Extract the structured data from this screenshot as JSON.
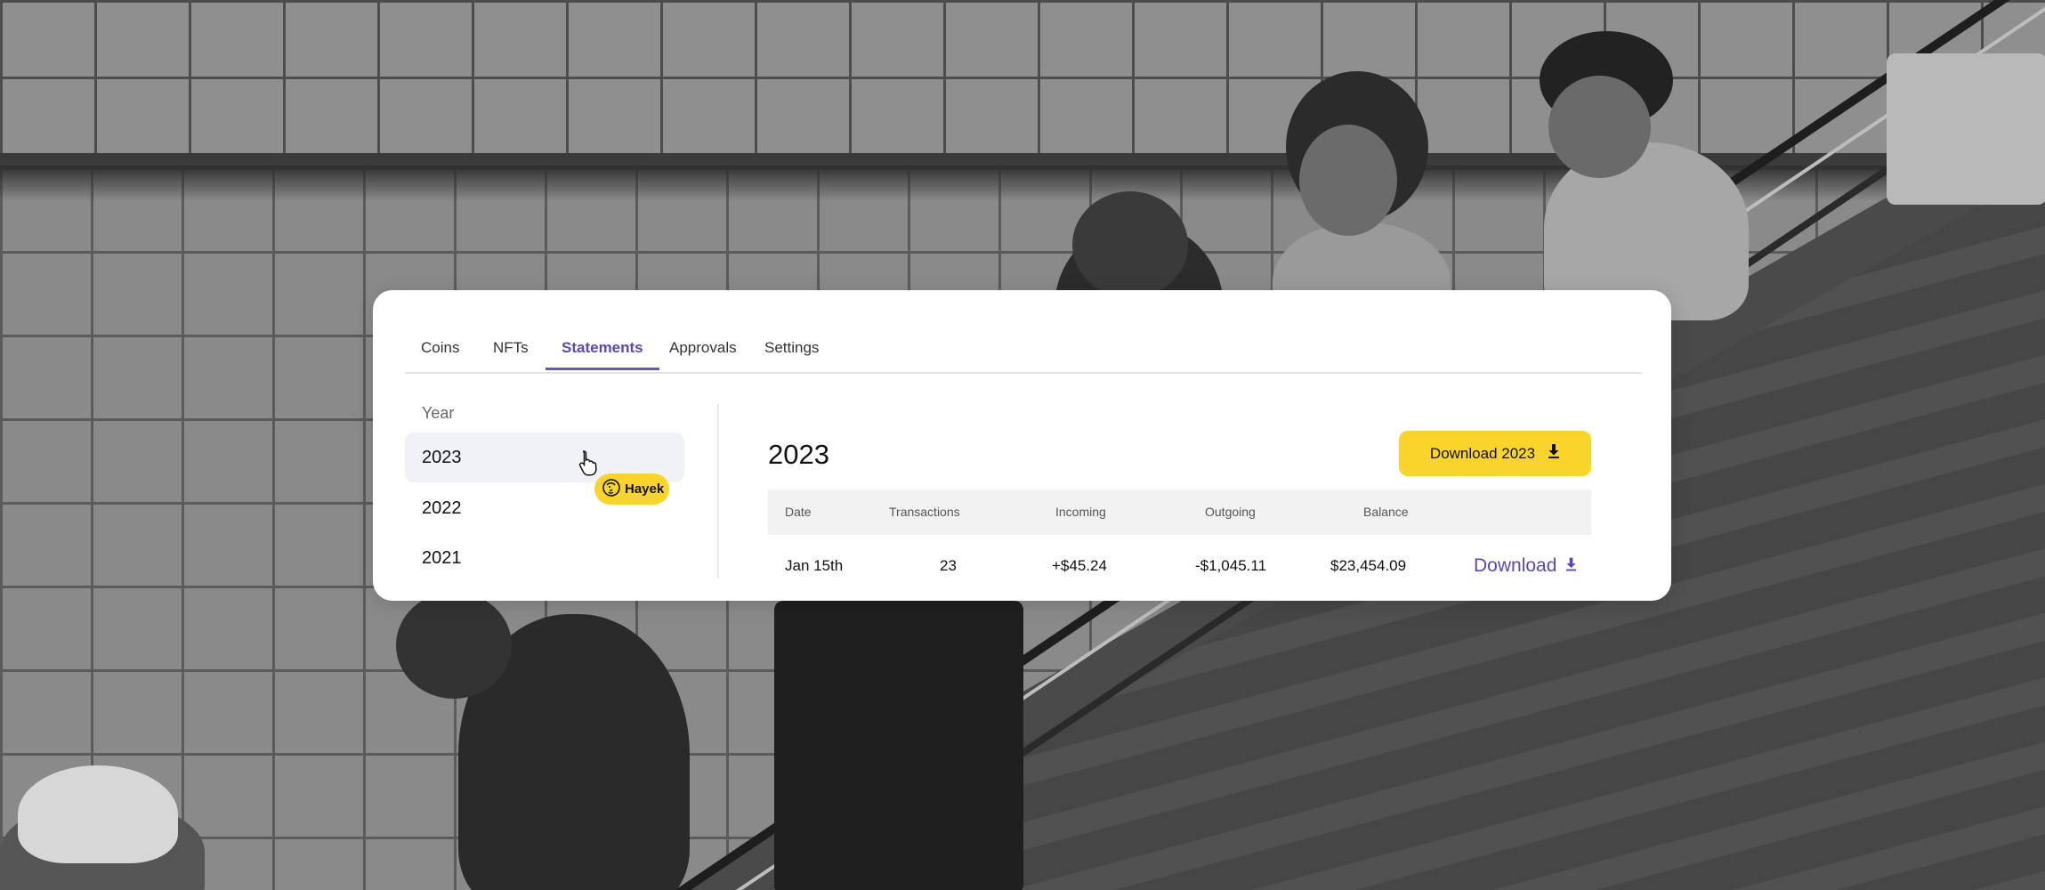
{
  "tabs": [
    {
      "label": "Coins"
    },
    {
      "label": "NFTs"
    },
    {
      "label": "Statements",
      "active": true
    },
    {
      "label": "Approvals"
    },
    {
      "label": "Settings"
    }
  ],
  "sidebar": {
    "label": "Year",
    "years": [
      {
        "label": "2023",
        "selected": true
      },
      {
        "label": "2022"
      },
      {
        "label": "2021"
      }
    ]
  },
  "main": {
    "title": "2023",
    "download_year_label": "Download 2023"
  },
  "table": {
    "headers": [
      "Date",
      "Transactions",
      "Incoming",
      "Outgoing",
      "Balance"
    ],
    "rows": [
      {
        "date": "Jan 15th",
        "transactions": "23",
        "incoming": "+$45.24",
        "outgoing": "-$1,045.11",
        "balance": "$23,454.09",
        "action": "Download"
      }
    ]
  },
  "cursor_badge": {
    "label": "Hayek"
  },
  "colors": {
    "accent": "#5a48b5",
    "button": "#f9d52b",
    "selected_row": "#f1f2f8",
    "table_header": "#f2f2f3"
  },
  "icons": [
    "download-icon",
    "pointer-hand-icon",
    "hayek-avatar-icon"
  ]
}
